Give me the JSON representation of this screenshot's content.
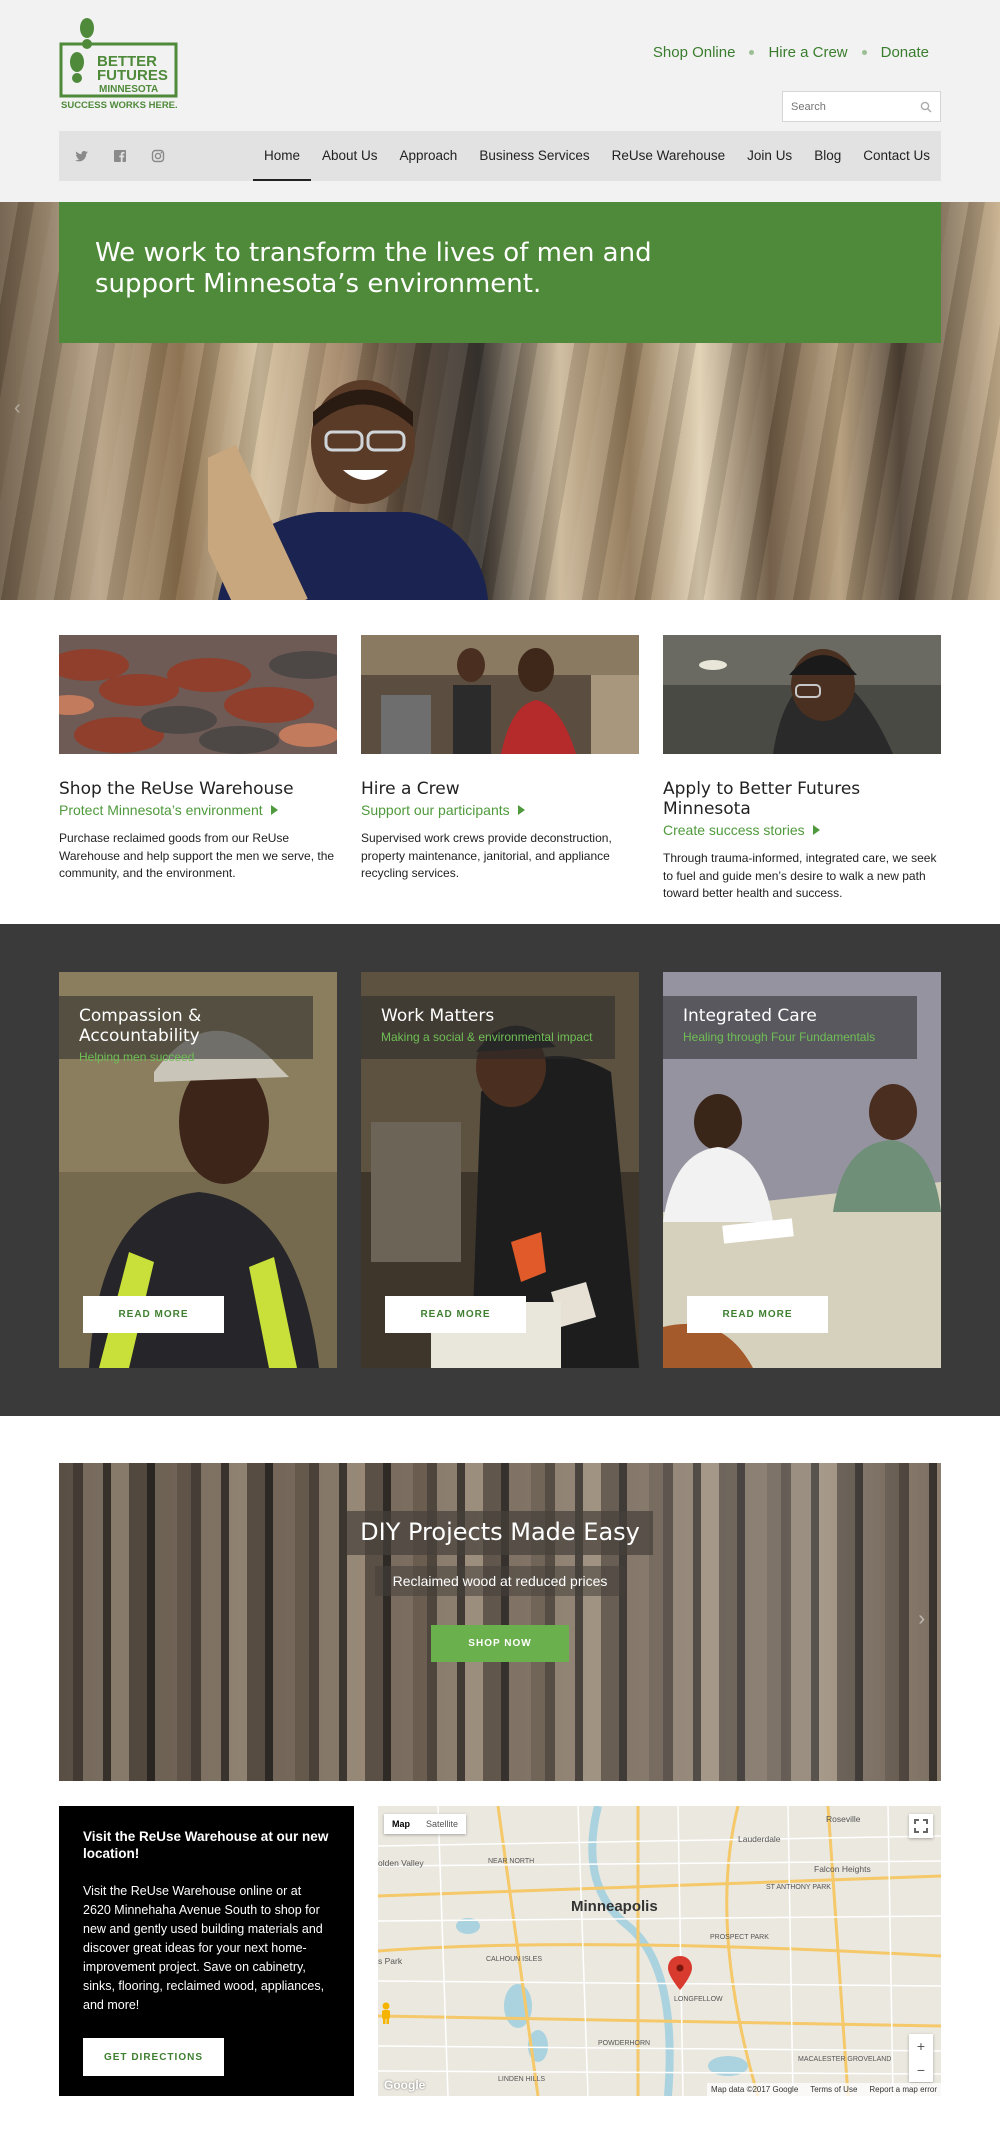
{
  "header": {
    "logo": {
      "line1": "BETTER",
      "line2": "FUTURES",
      "line3": "MINNESOTA",
      "tagline": "SUCCESS WORKS HERE."
    },
    "top_links": [
      "Shop Online",
      "Hire a Crew",
      "Donate"
    ],
    "search_placeholder": "Search",
    "social": [
      "twitter-icon",
      "facebook-icon",
      "instagram-icon"
    ],
    "menu": [
      "Home",
      "About Us",
      "Approach",
      "Business Services",
      "ReUse Warehouse",
      "Join Us",
      "Blog",
      "Contact Us"
    ],
    "active_menu": "Home"
  },
  "hero": {
    "headline": "We work to transform the lives of men and support Minnesota’s environment."
  },
  "features": [
    {
      "title": "Shop the ReUse Warehouse",
      "link": "Protect Minnesota’s environment",
      "text": "Purchase reclaimed goods from our ReUse Warehouse and help support the men we serve, the community, and the environment."
    },
    {
      "title": "Hire a Crew",
      "link": "Support our participants",
      "text": "Supervised work crews provide deconstruction, property maintenance, janitorial, and appliance recycling services."
    },
    {
      "title": "Apply to Better Futures Minnesota",
      "link": "Create success stories",
      "text": "Through trauma-informed, integrated care, we seek to fuel and guide men’s desire to walk a new path toward better health and success."
    }
  ],
  "cards": [
    {
      "title": "Compassion & Accountability",
      "tag": "Helping men succeed",
      "button": "READ MORE"
    },
    {
      "title": "Work Matters",
      "tag": "Making a social & environmental impact",
      "button": "READ MORE"
    },
    {
      "title": "Integrated Care",
      "tag": "Healing through Four Fundamentals",
      "button": "READ MORE"
    }
  ],
  "diy": {
    "title": "DIY Projects Made Easy",
    "tagline": "Reclaimed wood at reduced prices",
    "button": "SHOP NOW"
  },
  "location": {
    "title": "Visit the ReUse Warehouse at our new location!",
    "text": "Visit the ReUse Warehouse online or at 2620 Minnehaha Avenue South to shop for new and gently used building materials and discover great ideas for your next home-improvement project. Save on cabinetry, sinks, flooring, reclaimed wood, appliances, and more!",
    "button": "GET DIRECTIONS"
  },
  "map": {
    "tabs": [
      "Map",
      "Satellite"
    ],
    "city": "Minneapolis",
    "labels": [
      "Roseville",
      "Lauderdale",
      "Falcon Heights",
      "olden Valley",
      "NEAR NORTH",
      "ST ANTHONY PARK",
      "PROSPECT PARK",
      "CALHOUN ISLES",
      "LONGFELLOW",
      "POWDERHORN",
      "LINDEN HILLS",
      "MACALESTER GROVELAND",
      "s Park"
    ],
    "attribution": [
      "Map data ©2017 Google",
      "Terms of Use",
      "Report a map error"
    ],
    "google": "Google",
    "zoom_in": "+",
    "zoom_out": "−"
  },
  "colors": {
    "brand_green": "#4f8a3a",
    "link_green": "#4f9a3c",
    "dark_bg": "#3a3a3a"
  }
}
